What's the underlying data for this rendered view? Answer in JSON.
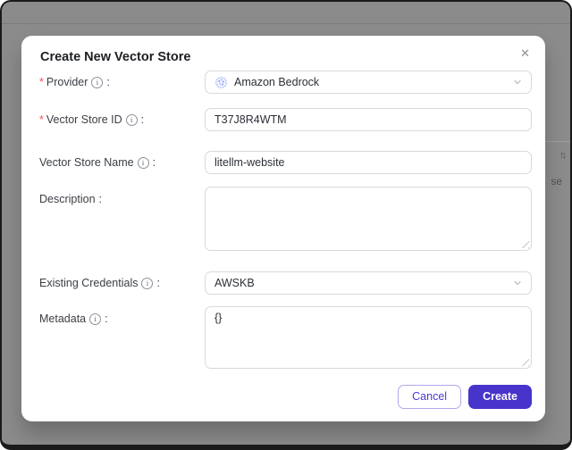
{
  "ui": {
    "required_mark": "*",
    "colon": ":",
    "info_glyph": "i",
    "close_glyph": "✕"
  },
  "background": {
    "sort_indicator": "↑↓",
    "partial_text": "se"
  },
  "modal": {
    "title": "Create New Vector Store",
    "fields": [
      {
        "label": "Provider",
        "required": true,
        "value": "Amazon Bedrock"
      },
      {
        "label": "Vector Store ID",
        "required": true,
        "value": "T37J8R4WTM"
      },
      {
        "label": "Vector Store Name",
        "required": false,
        "value": "litellm-website"
      },
      {
        "label": "Description",
        "required": false,
        "value": ""
      },
      {
        "label": "Existing Credentials",
        "required": false,
        "value": "AWSKB"
      },
      {
        "label": "Metadata",
        "required": false,
        "value": "{}"
      }
    ],
    "buttons": {
      "cancel": "Cancel",
      "create": "Create"
    }
  },
  "colors": {
    "accent": "#4634cb",
    "overlay": "#8b8b8b",
    "required_mark": "#ff4d4f",
    "field_border": "#d9d9d9",
    "bedrock_icon_blue": "#8aa3f6"
  }
}
